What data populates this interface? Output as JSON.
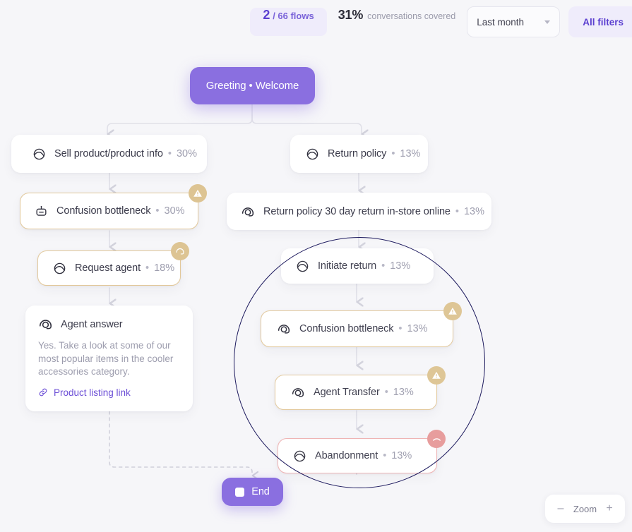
{
  "header": {
    "flows_count": "2",
    "flows_total": "/ 66 flows",
    "coverage_pct": "31%",
    "coverage_label": "conversations covered",
    "date_filter": "Last month",
    "all_filters": "All filters"
  },
  "flow": {
    "root": {
      "label": "Greeting • Welcome"
    },
    "nodes": [
      {
        "id": "sell-product",
        "icon": "intent-icon",
        "label": "Sell product/product info",
        "pct": "30%",
        "state": "normal",
        "badge": null
      },
      {
        "id": "confusion-left",
        "icon": "bot-icon",
        "label": "Confusion bottleneck",
        "pct": "30%",
        "state": "warn",
        "badge": "warning-icon"
      },
      {
        "id": "request-agent",
        "icon": "intent-icon",
        "label": "Request agent",
        "pct": "18%",
        "state": "warn",
        "badge": "agent-icon"
      },
      {
        "id": "return-policy",
        "icon": "intent-icon",
        "label": "Return policy",
        "pct": "13%",
        "state": "normal",
        "badge": null
      },
      {
        "id": "return-policy-30day",
        "icon": "agent-icon",
        "label": "Return policy 30 day return in-store online",
        "pct": "13%",
        "state": "normal",
        "badge": null
      },
      {
        "id": "initiate-return",
        "icon": "intent-icon",
        "label": "Initiate return",
        "pct": "13%",
        "state": "normal",
        "badge": null
      },
      {
        "id": "confusion-right",
        "icon": "agent-icon",
        "label": "Confusion bottleneck",
        "pct": "13%",
        "state": "warn",
        "badge": "warning-icon"
      },
      {
        "id": "agent-transfer",
        "icon": "agent-icon",
        "label": "Agent Transfer",
        "pct": "13%",
        "state": "warn",
        "badge": "warning-icon"
      },
      {
        "id": "abandonment",
        "icon": "intent-icon",
        "label": "Abandonment",
        "pct": "13%",
        "state": "danger",
        "badge": "hangup-icon"
      }
    ],
    "answer_card": {
      "icon": "agent-icon",
      "title": "Agent answer",
      "body": "Yes. Take a look at some of our most popular items in the cooler accessories category.",
      "link_icon": "link-icon",
      "link_text": "Product listing link"
    },
    "end": {
      "label": "End"
    },
    "separator": "•"
  },
  "zoom_control": {
    "minus": "–",
    "label": "Zoom",
    "plus": "+"
  },
  "colors": {
    "accent": "#6c4fd6",
    "accent_node": "#8a6fe0",
    "warn_border": "#e2c89a",
    "warn_badge": "#ddc493",
    "danger_border": "#efb2b2",
    "danger_badge": "#e79a9a",
    "spotlight": "#1d1a5e",
    "canvas_bg": "#f6f6f9"
  }
}
